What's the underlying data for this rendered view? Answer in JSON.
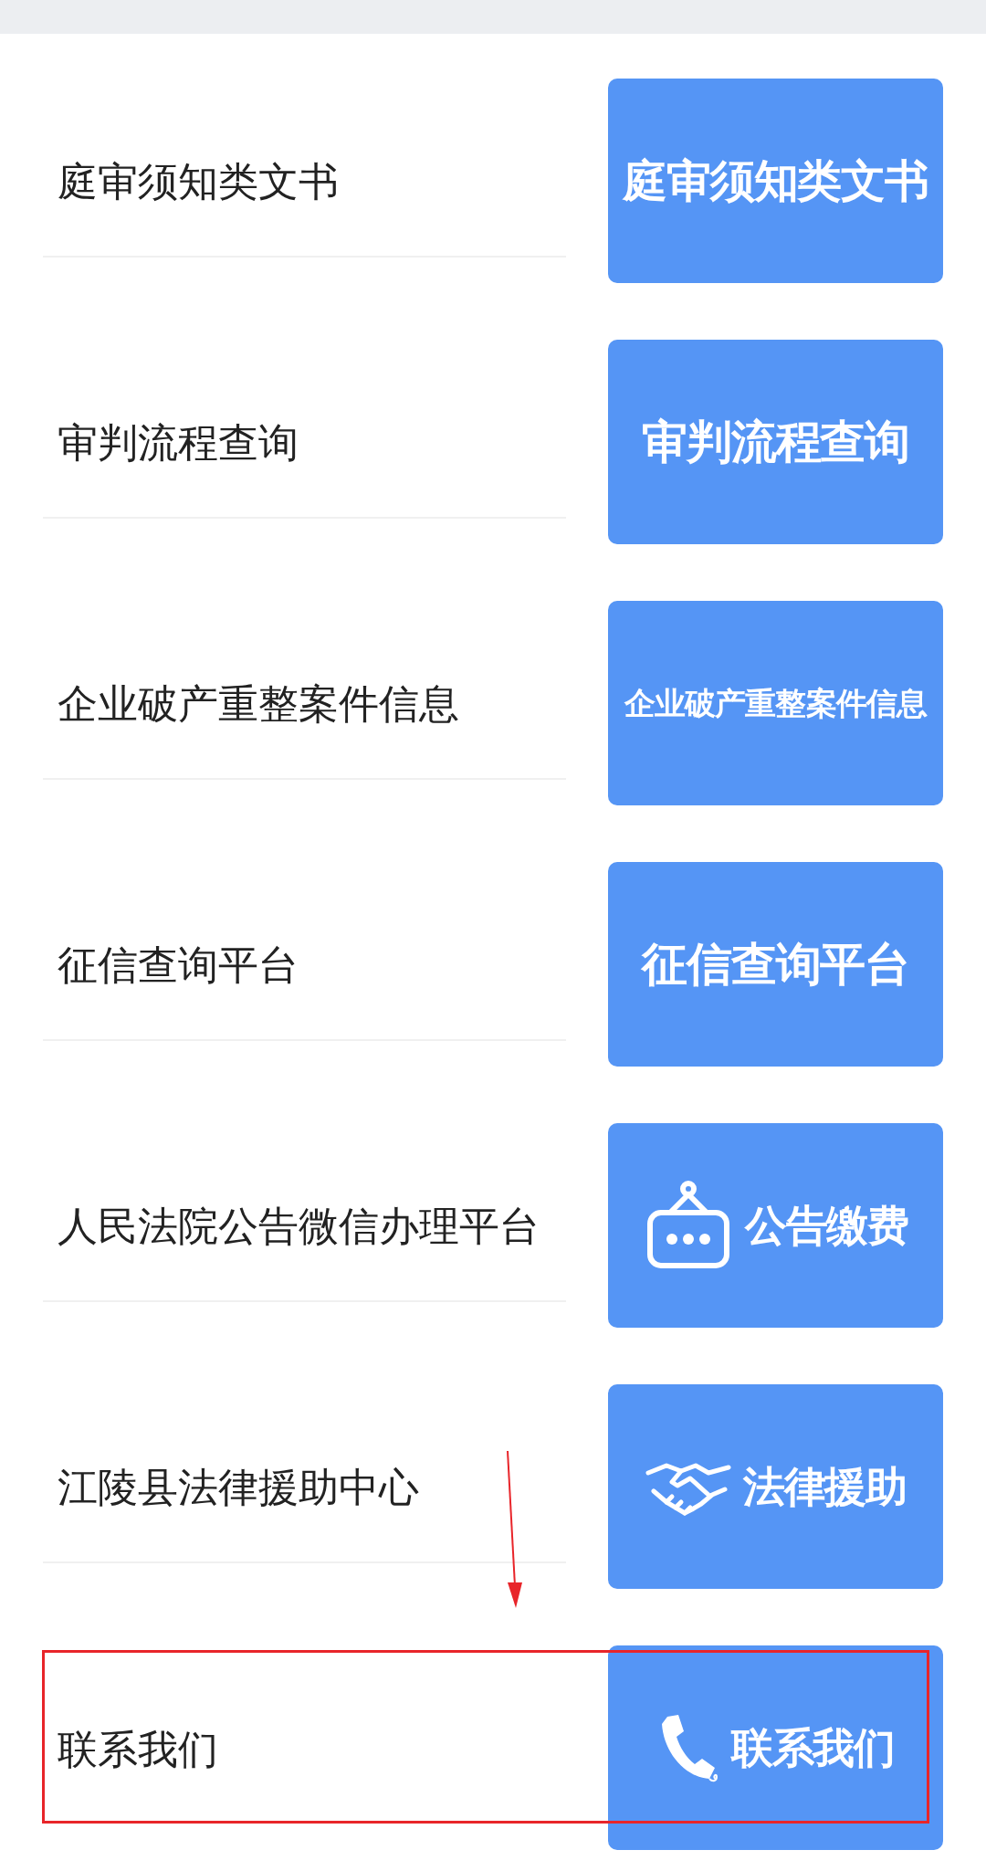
{
  "items": [
    {
      "label": "庭审须知类文书",
      "tile": {
        "kind": "text",
        "text": "庭审须知类文书"
      }
    },
    {
      "label": "审判流程查询",
      "tile": {
        "kind": "text",
        "text": "审判流程查询"
      }
    },
    {
      "label": "企业破产重整案件信息",
      "tile": {
        "kind": "text",
        "text": "企业破产重整案件信息"
      }
    },
    {
      "label": "征信查询平台",
      "tile": {
        "kind": "text",
        "text": "征信查询平台"
      }
    },
    {
      "label": "人民法院公告微信办理平台",
      "tile": {
        "kind": "sign",
        "text": "公告缴费"
      }
    },
    {
      "label": "江陵县法律援助中心",
      "tile": {
        "kind": "handshake",
        "text": "法律援助"
      }
    },
    {
      "label": "联系我们",
      "tile": {
        "kind": "phone",
        "text": "联系我们"
      }
    }
  ]
}
